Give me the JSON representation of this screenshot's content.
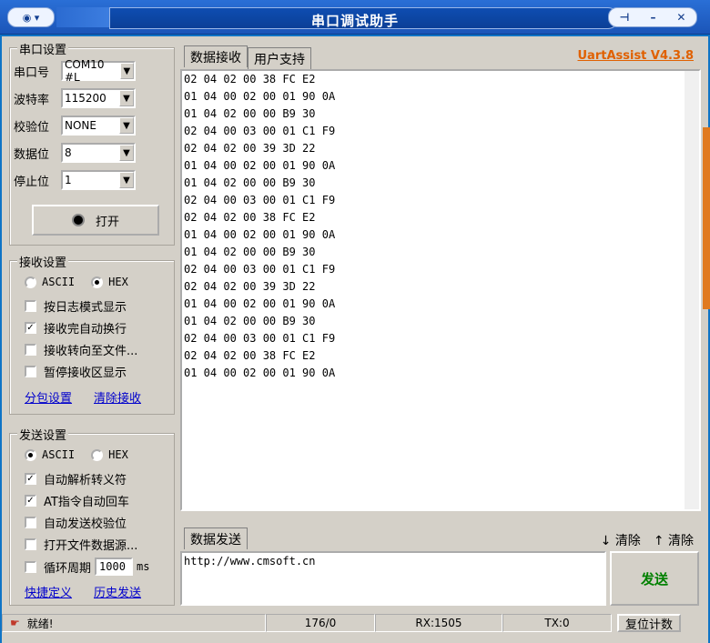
{
  "window": {
    "title": "串口调试助手"
  },
  "serial": {
    "legend": "串口设置",
    "port_label": "串口号",
    "port_value": "COM10 #L",
    "baud_label": "波特率",
    "baud_value": "115200",
    "parity_label": "校验位",
    "parity_value": "NONE",
    "data_label": "数据位",
    "data_value": "8",
    "stop_label": "停止位",
    "stop_value": "1",
    "open_label": "打开"
  },
  "receive_settings": {
    "legend": "接收设置",
    "ascii": "ASCII",
    "hex": "HEX",
    "opt1": "按日志模式显示",
    "opt2": "接收完自动换行",
    "opt3": "接收转向至文件...",
    "opt4": "暂停接收区显示",
    "link1": "分包设置",
    "link2": "清除接收"
  },
  "send_settings": {
    "legend": "发送设置",
    "ascii": "ASCII",
    "hex": "HEX",
    "opt1": "自动解析转义符",
    "opt2": "AT指令自动回车",
    "opt3": "自动发送校验位",
    "opt4": "打开文件数据源...",
    "opt5": "循环周期",
    "period_value": "1000",
    "period_unit": "ms",
    "link1": "快捷定义",
    "link2": "历史发送"
  },
  "tabs": {
    "receive": "数据接收",
    "support": "用户支持",
    "version": "UartAssist V4.3.8"
  },
  "receive_lines": [
    "02 04 02 00 38 FC E2",
    "01 04 00 02 00 01 90 0A",
    "01 04 02 00 00 B9 30",
    "02 04 00 03 00 01 C1 F9",
    "02 04 02 00 39 3D 22",
    "01 04 00 02 00 01 90 0A",
    "01 04 02 00 00 B9 30",
    "02 04 00 03 00 01 C1 F9",
    "02 04 02 00 38 FC E2",
    "01 04 00 02 00 01 90 0A",
    "01 04 02 00 00 B9 30",
    "02 04 00 03 00 01 C1 F9",
    "02 04 02 00 39 3D 22",
    "01 04 00 02 00 01 90 0A",
    "01 04 02 00 00 B9 30",
    "02 04 00 03 00 01 C1 F9",
    "02 04 02 00 38 FC E2",
    "01 04 00 02 00 01 90 0A"
  ],
  "send": {
    "tab": "数据发送",
    "clear1": "清除",
    "clear2": "清除",
    "value": "http://www.cmsoft.cn",
    "button": "发送"
  },
  "status": {
    "ready": "就绪!",
    "count": "176/0",
    "rx": "RX:1505",
    "tx": "TX:0",
    "reset": "复位计数"
  }
}
